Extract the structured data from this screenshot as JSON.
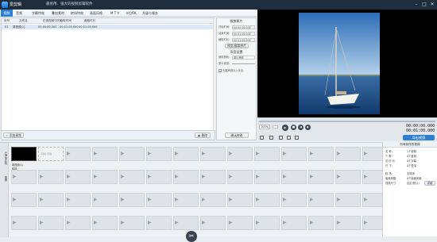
{
  "app": {
    "title": "爱剪辑",
    "subtitle": "最易用、强大的视频剪辑软件"
  },
  "window": {
    "min": "–",
    "max": "□",
    "close": "✕"
  },
  "tabs": [
    "视频",
    "音频",
    "字幕特效",
    "叠加素材",
    "转场特效",
    "画面风格",
    "M T V",
    "卡拉OK",
    "升级与服务"
  ],
  "clip_list": {
    "columns": [
      "序号",
      "文件名",
      "在源视频中的截取时间",
      "",
      "截取时长"
    ],
    "rows": [
      {
        "index": "01",
        "name": "原视频(1)",
        "range": "00:00:00.000 - 00:01:00.000",
        "duration": "00:01:00.000"
      }
    ]
  },
  "list_footer": {
    "add_video": "添加视频",
    "delete": "删除"
  },
  "settings": {
    "clip_title": "裁剪原片",
    "start_label": "开始时间:",
    "start_value": "00:00:00.000",
    "end_label": "结束时间:",
    "end_value": "00:01:00.000",
    "length_label": "截取时长:",
    "length_value": "00:01:00.000",
    "preview_btn": "预览/截取原片",
    "sound_title": "声音设置",
    "track_label": "使用音轨:",
    "track_value": "原片音频",
    "volume_label": "原片音量:",
    "head_tail_label": "头尾声音淡入淡出",
    "confirm": "确认修改"
  },
  "player": {
    "zoom": "100%",
    "progress": 0.0,
    "time_current": "00:00:00.000",
    "time_total": "00:01:00.000"
  },
  "export": "导出视频",
  "timeline": {
    "vtabs": [
      "已添加片段",
      "视频"
    ],
    "first_clip_label": "原视频(1)",
    "first_clip_sub": "转场",
    "placeholder_text": "转场/字幕"
  },
  "info_panel": {
    "title": "所有制作的视频",
    "rows": [
      {
        "label": "名   称:",
        "value": "1个视频"
      },
      {
        "label": "个   数:",
        "value": "0个音频"
      },
      {
        "label": "总 时 长:",
        "value": "0个字幕"
      },
      {
        "label": "尺   寸:",
        "value": "0个叠加"
      },
      {
        "label": "转   场:",
        "value": "无转场"
      },
      {
        "label": "画面风格:",
        "value": "0个画面风格"
      },
      {
        "label": "视频尺寸:",
        "value": "自定(默认)"
      }
    ],
    "edit_btn": "详细"
  }
}
